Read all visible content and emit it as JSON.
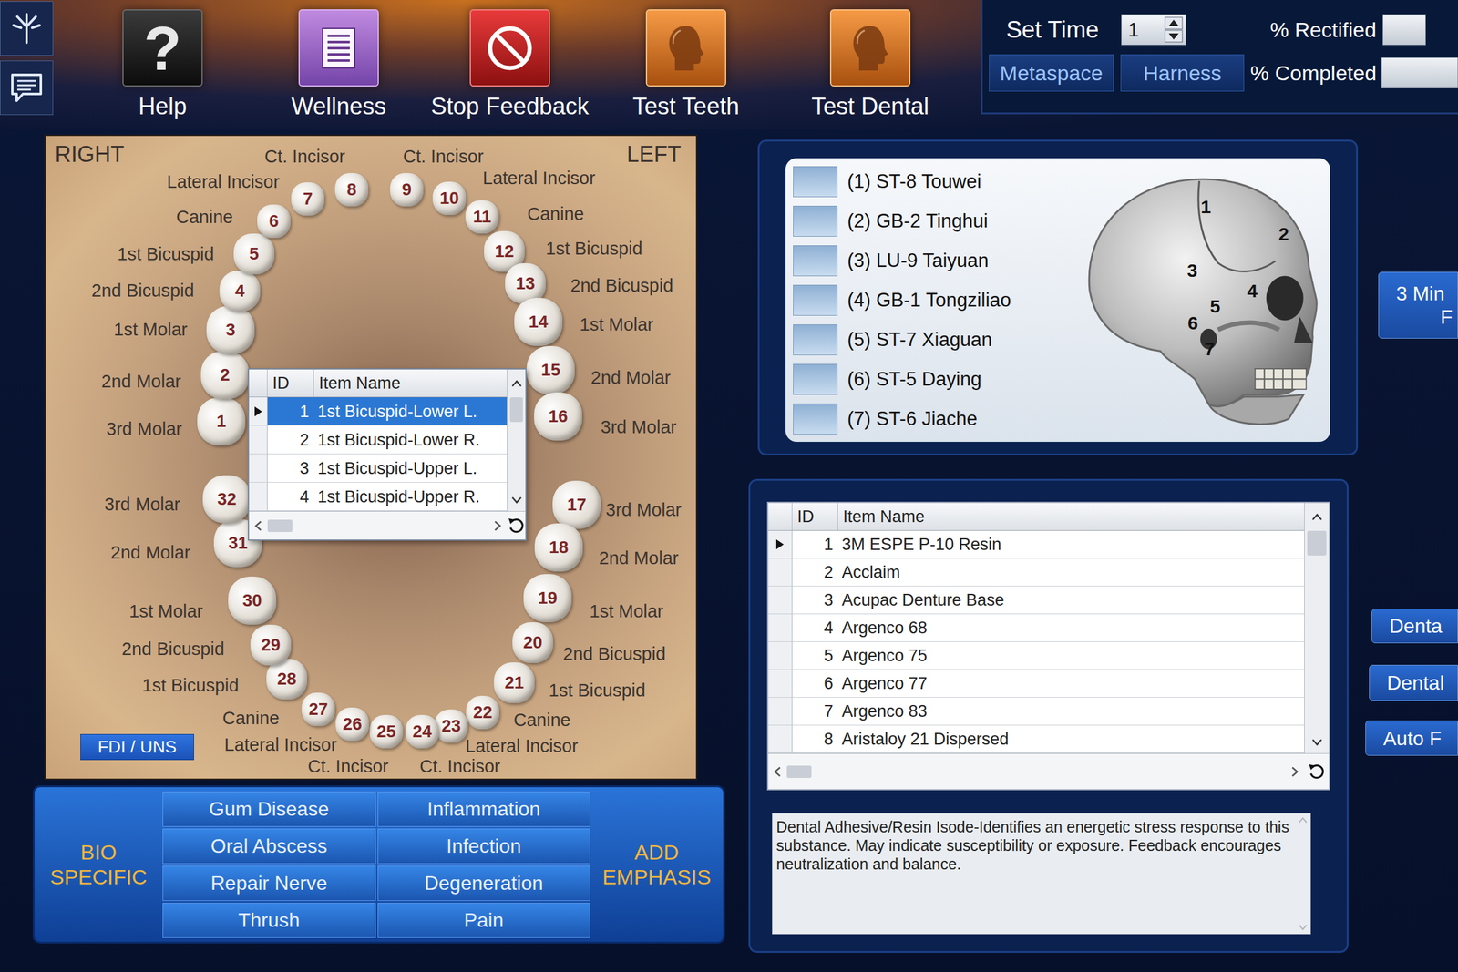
{
  "toolbar": [
    {
      "label": "Help",
      "glyph": "?",
      "kind": "help"
    },
    {
      "label": "Wellness",
      "kind": "wellness"
    },
    {
      "label": "Stop Feedback",
      "kind": "stop"
    },
    {
      "label": "Test Teeth",
      "kind": "head"
    },
    {
      "label": "Test Dental",
      "kind": "head"
    }
  ],
  "session": {
    "set_time_label": "Set Time",
    "set_time_value": "1",
    "rectified_label": "% Rectified",
    "completed_label": "% Completed",
    "buttons": [
      "Metaspace",
      "Harness"
    ]
  },
  "chart": {
    "side_labels": [
      "RIGHT",
      "LEFT"
    ],
    "tooth_labels": [
      "Ct. Incisor",
      "Ct. Incisor",
      "Lateral Incisor",
      "Lateral Incisor",
      "Canine",
      "Canine",
      "1st Bicuspid",
      "1st Bicuspid",
      "2nd Bicuspid",
      "2nd Bicuspid",
      "1st Molar",
      "1st Molar",
      "2nd Molar",
      "2nd Molar",
      "3rd Molar",
      "3rd Molar",
      "3rd Molar",
      "3rd Molar",
      "2nd Molar",
      "2nd Molar",
      "1st Molar",
      "1st Molar",
      "2nd Bicuspid",
      "2nd Bicuspid",
      "1st Bicuspid",
      "1st Bicuspid",
      "Canine",
      "Canine",
      "Lateral Incisor",
      "Lateral Incisor",
      "Ct. Incisor",
      "Ct. Incisor"
    ],
    "teeth": [
      "1",
      "2",
      "3",
      "4",
      "5",
      "6",
      "7",
      "8",
      "9",
      "10",
      "11",
      "12",
      "13",
      "14",
      "15",
      "16",
      "17",
      "18",
      "19",
      "20",
      "21",
      "22",
      "23",
      "24",
      "25",
      "26",
      "27",
      "28",
      "29",
      "30",
      "31",
      "32"
    ],
    "system_button": "FDI / UNS"
  },
  "tooth_list": {
    "columns": [
      "ID",
      "Item Name"
    ],
    "rows": [
      {
        "id": "1",
        "name": "1st Bicuspid-Lower L.",
        "selected": true
      },
      {
        "id": "2",
        "name": "1st Bicuspid-Lower R.",
        "selected": false
      },
      {
        "id": "3",
        "name": "1st Bicuspid-Upper L.",
        "selected": false
      },
      {
        "id": "4",
        "name": "1st Bicuspid-Upper R.",
        "selected": false
      }
    ]
  },
  "bio": {
    "title": "BIO SPECIFIC",
    "buttons": [
      "Gum Disease",
      "Inflammation",
      "Oral Abscess",
      "Infection",
      "Repair Nerve",
      "Degeneration",
      "Thrush",
      "Pain"
    ],
    "emphasis": "ADD EMPHASIS"
  },
  "acupoints": {
    "items": [
      {
        "label": "(1) ST-8 Touwei",
        "checked": false
      },
      {
        "label": "(2) GB-2 Tinghui",
        "checked": false
      },
      {
        "label": "(3) LU-9 Taiyuan",
        "checked": false
      },
      {
        "label": "(4) GB-1 Tongziliao",
        "checked": false
      },
      {
        "label": "(5) ST-7 Xiaguan",
        "checked": false
      },
      {
        "label": "(6) ST-5 Daying",
        "checked": false
      },
      {
        "label": "(7) ST-6 Jiache",
        "checked": false
      }
    ],
    "skull_labels": [
      "1",
      "2",
      "3",
      "4",
      "5",
      "6",
      "7"
    ]
  },
  "materials": {
    "columns": [
      "ID",
      "Item Name"
    ],
    "rows": [
      {
        "id": "1",
        "name": "3M ESPE P-10 Resin",
        "selected": true
      },
      {
        "id": "2",
        "name": "Acclaim",
        "selected": false
      },
      {
        "id": "3",
        "name": "Acupac Denture Base",
        "selected": false
      },
      {
        "id": "4",
        "name": "Argenco 68",
        "selected": false
      },
      {
        "id": "5",
        "name": "Argenco 75",
        "selected": false
      },
      {
        "id": "6",
        "name": "Argenco 77",
        "selected": false
      },
      {
        "id": "7",
        "name": "Argenco 83",
        "selected": false
      },
      {
        "id": "8",
        "name": "Aristaloy 21 Dispersed",
        "selected": false
      }
    ],
    "description": "Dental Adhesive/Resin Isode-Identifies an energetic stress response to this substance. May indicate susceptibility or exposure. Feedback encourages neutralization and balance."
  },
  "side_buttons": [
    {
      "lines": [
        "3 Min",
        "F"
      ]
    },
    {
      "lines": [
        "Denta"
      ]
    },
    {
      "lines": [
        "Dental"
      ]
    },
    {
      "lines": [
        "Auto F"
      ]
    }
  ]
}
